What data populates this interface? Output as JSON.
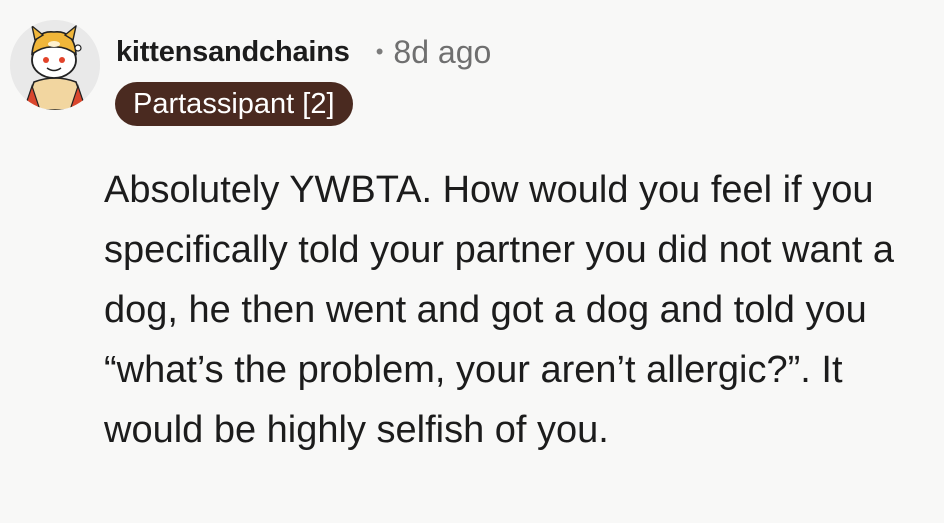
{
  "comment": {
    "avatar_icon": "snoo-avatar-icon",
    "username": "kittensandchains",
    "separator": "•",
    "age": "8d ago",
    "flair": "Partassipant [2]",
    "flair_color": "#4a2a20",
    "body": "Absolutely YWBTA. How would you feel if you specifically told your partner you did not want a dog, he then went and got a dog and told you “what’s the problem, your aren’t allergic?”. It would be highly selfish of you."
  }
}
